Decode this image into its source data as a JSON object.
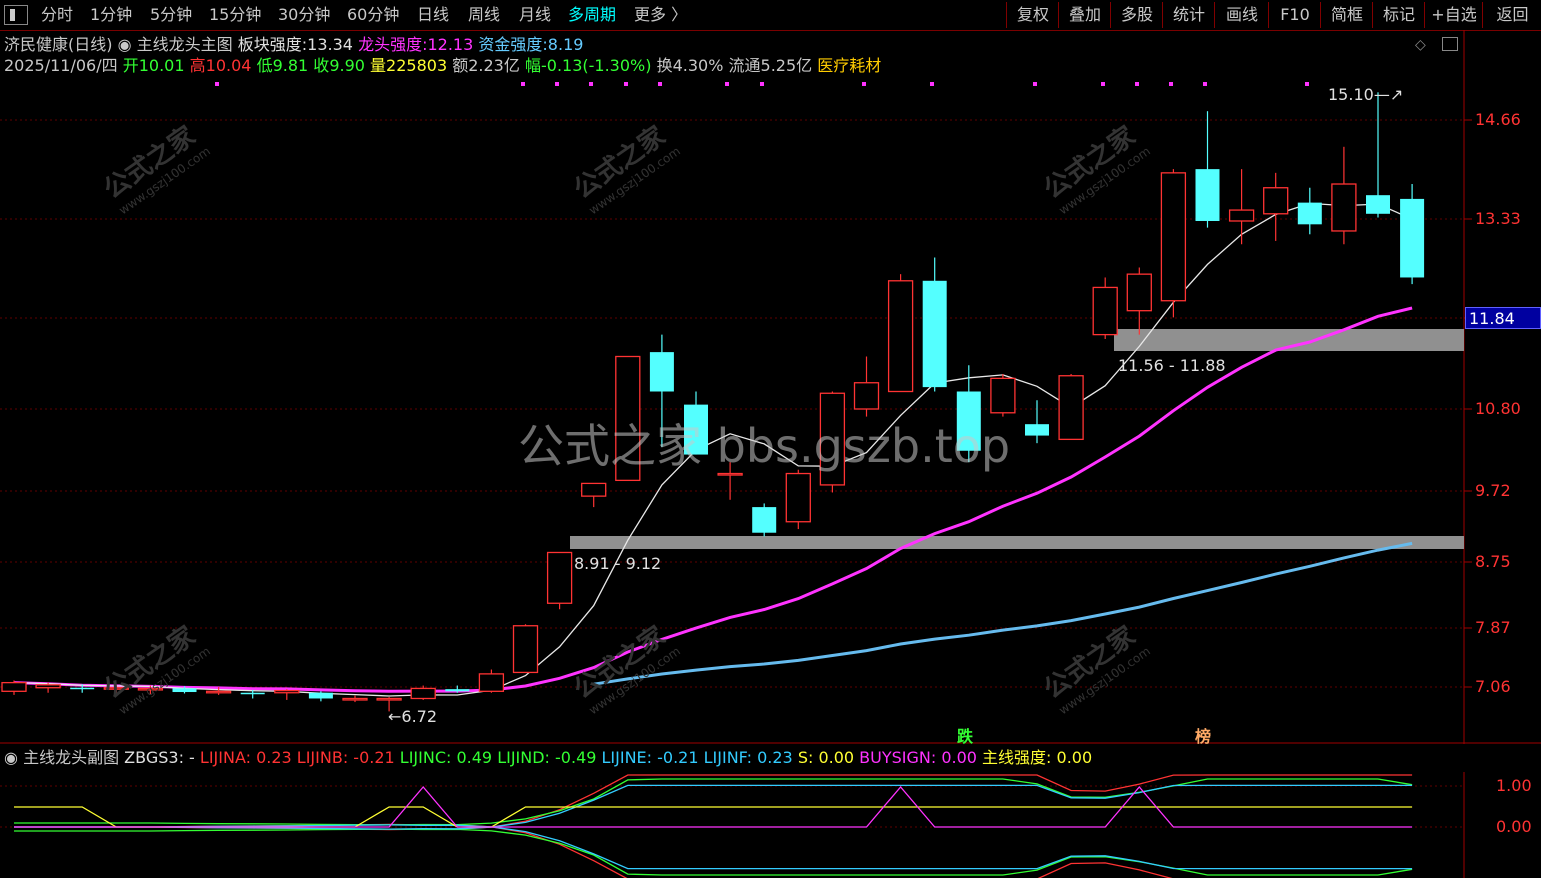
{
  "topbar": {
    "periods": [
      "分时",
      "1分钟",
      "5分钟",
      "15分钟",
      "30分钟",
      "60分钟",
      "日线",
      "周线",
      "月线",
      "多周期",
      "更多 〉"
    ],
    "active_period": "多周期",
    "right_buttons": [
      "复权",
      "叠加",
      "多股",
      "统计",
      "画线",
      "F10",
      "简框",
      "标记",
      "+自选",
      "返回"
    ]
  },
  "header": {
    "stock": "济民健康(日线)",
    "indicator_name": "主线龙头主图",
    "sector_strength_label": "板块强度:",
    "sector_strength": "13.34",
    "leader_strength_label": "龙头强度:",
    "leader_strength": "12.13",
    "fund_strength_label": "资金强度:",
    "fund_strength": "8.19"
  },
  "quote": {
    "date": "2025/11/06/四",
    "open_label": "开",
    "open": "10.01",
    "high_label": "高",
    "high": "10.04",
    "low_label": "低",
    "low": "9.81",
    "close_label": "收",
    "close": "9.90",
    "volume_label": "量",
    "volume": "225803",
    "amount_label": "额",
    "amount": "2.23亿",
    "change_label": "幅",
    "change": "-0.13(-1.30%)",
    "turnover_label": "换",
    "turnover": "4.30%",
    "float_label": "流通",
    "float": "5.25亿",
    "sector": "医疗耗材"
  },
  "price_axis": [
    "14.66",
    "13.33",
    "11.84",
    "10.80",
    "9.72",
    "8.75",
    "7.87",
    "7.06"
  ],
  "current_price": "11.84",
  "annotations": {
    "high_mark": "15.10",
    "low_mark": "6.72",
    "zone_upper": "11.56 - 11.88",
    "zone_lower": "8.91 - 9.12",
    "signal_fall": "跌",
    "signal_list": "榜"
  },
  "watermark": {
    "center": "公式之家 bbs.gszb.top",
    "tile_cn": "公式之家",
    "tile_en": "www.gszj100.com"
  },
  "subchart": {
    "name": "主线龙头副图",
    "formula": "ZBGS3: -",
    "items": [
      {
        "label": "LIJINA: 0.23",
        "color": "#ff3333"
      },
      {
        "label": "LIJINB: -0.21",
        "color": "#ff3333"
      },
      {
        "label": "LIJINC: 0.49",
        "color": "#33ff33"
      },
      {
        "label": "LIJIND: -0.49",
        "color": "#33ff33"
      },
      {
        "label": "LIJINE: -0.21",
        "color": "#33ccff"
      },
      {
        "label": "LIJINF: 0.23",
        "color": "#33ccff"
      },
      {
        "label": "S: 0.00",
        "color": "#ffff33"
      },
      {
        "label": "BUYSIGN: 0.00",
        "color": "#ff33ff"
      },
      {
        "label": "主线强度: 0.00",
        "color": "#ffff33"
      }
    ],
    "axis": [
      "1.00",
      "0.00"
    ]
  },
  "chart_data": {
    "type": "candlestick",
    "ylim": [
      6.5,
      15.3
    ],
    "candles": [
      {
        "o": 7.0,
        "h": 7.15,
        "l": 6.95,
        "c": 7.12
      },
      {
        "o": 7.05,
        "h": 7.12,
        "l": 6.98,
        "c": 7.09
      },
      {
        "o": 7.05,
        "h": 7.1,
        "l": 6.98,
        "c": 7.04
      },
      {
        "o": 7.04,
        "h": 7.08,
        "l": 6.98,
        "c": 7.05
      },
      {
        "o": 7.02,
        "h": 7.08,
        "l": 6.96,
        "c": 7.04
      },
      {
        "o": 7.04,
        "h": 7.07,
        "l": 6.97,
        "c": 6.99
      },
      {
        "o": 7.0,
        "h": 7.06,
        "l": 6.95,
        "c": 7.0
      },
      {
        "o": 6.98,
        "h": 7.02,
        "l": 6.9,
        "c": 6.96
      },
      {
        "o": 6.98,
        "h": 7.03,
        "l": 6.88,
        "c": 7.01
      },
      {
        "o": 6.98,
        "h": 7.0,
        "l": 6.86,
        "c": 6.9
      },
      {
        "o": 6.9,
        "h": 6.94,
        "l": 6.85,
        "c": 6.9
      },
      {
        "o": 6.88,
        "h": 6.92,
        "l": 6.72,
        "c": 6.9
      },
      {
        "o": 6.9,
        "h": 7.08,
        "l": 6.88,
        "c": 7.04
      },
      {
        "o": 7.03,
        "h": 7.08,
        "l": 6.98,
        "c": 7.0
      },
      {
        "o": 7.0,
        "h": 7.3,
        "l": 6.98,
        "c": 7.24
      },
      {
        "o": 7.26,
        "h": 7.92,
        "l": 7.26,
        "c": 7.9
      },
      {
        "o": 8.2,
        "h": 8.88,
        "l": 8.12,
        "c": 8.88
      },
      {
        "o": 9.65,
        "h": 9.82,
        "l": 9.5,
        "c": 9.82
      },
      {
        "o": 9.86,
        "h": 11.4,
        "l": 9.86,
        "c": 11.4
      },
      {
        "o": 11.45,
        "h": 11.65,
        "l": 10.3,
        "c": 11.0
      },
      {
        "o": 10.85,
        "h": 11.0,
        "l": 10.2,
        "c": 10.2
      },
      {
        "o": 9.95,
        "h": 10.1,
        "l": 9.6,
        "c": 9.95
      },
      {
        "o": 9.5,
        "h": 9.55,
        "l": 9.1,
        "c": 9.15
      },
      {
        "o": 9.3,
        "h": 10.0,
        "l": 9.2,
        "c": 9.95
      },
      {
        "o": 9.8,
        "h": 11.0,
        "l": 9.7,
        "c": 10.98
      },
      {
        "o": 10.8,
        "h": 11.4,
        "l": 10.7,
        "c": 11.1
      },
      {
        "o": 11.0,
        "h": 12.5,
        "l": 11.0,
        "c": 12.4
      },
      {
        "o": 12.4,
        "h": 12.75,
        "l": 11.0,
        "c": 11.05
      },
      {
        "o": 11.0,
        "h": 11.3,
        "l": 10.1,
        "c": 10.25
      },
      {
        "o": 10.75,
        "h": 11.2,
        "l": 10.7,
        "c": 11.15
      },
      {
        "o": 10.6,
        "h": 10.9,
        "l": 10.35,
        "c": 10.45
      },
      {
        "o": 10.4,
        "h": 11.2,
        "l": 10.4,
        "c": 11.18
      },
      {
        "o": 11.65,
        "h": 12.45,
        "l": 11.6,
        "c": 12.3
      },
      {
        "o": 11.95,
        "h": 12.6,
        "l": 11.65,
        "c": 12.5
      },
      {
        "o": 12.1,
        "h": 14.0,
        "l": 11.85,
        "c": 13.95
      },
      {
        "o": 14.0,
        "h": 14.8,
        "l": 13.2,
        "c": 13.3
      },
      {
        "o": 13.3,
        "h": 14.0,
        "l": 12.95,
        "c": 13.45
      },
      {
        "o": 13.4,
        "h": 13.95,
        "l": 13.0,
        "c": 13.75
      },
      {
        "o": 13.55,
        "h": 13.75,
        "l": 13.1,
        "c": 13.25
      },
      {
        "o": 13.15,
        "h": 14.3,
        "l": 12.95,
        "c": 13.8
      },
      {
        "o": 13.65,
        "h": 15.1,
        "l": 13.35,
        "c": 13.4
      },
      {
        "o": 13.6,
        "h": 13.8,
        "l": 12.35,
        "c": 12.45
      }
    ]
  }
}
